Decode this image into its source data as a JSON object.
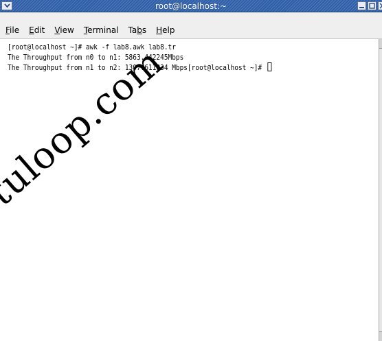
{
  "window": {
    "title": "root@localhost:~"
  },
  "menubar": {
    "items": [
      {
        "mnemonic": "F",
        "rest": "ile"
      },
      {
        "mnemonic": "E",
        "rest": "dit"
      },
      {
        "mnemonic": "V",
        "rest": "iew"
      },
      {
        "mnemonic": "T",
        "rest": "erminal"
      },
      {
        "pre": "Ta",
        "mnemonic": "b",
        "rest": "s"
      },
      {
        "mnemonic": "H",
        "rest": "elp"
      }
    ]
  },
  "terminal": {
    "lines": [
      "[root@localhost ~]# awk -f lab8.awk lab8.tr",
      "The Throughput from n0 to n1: 5863.442245Mbps",
      "The Throughput from n1 to n2: 1307.611834 Mbps[root@localhost ~]# "
    ]
  },
  "watermark": {
    "text": "vtuloop.com"
  },
  "icons": {
    "window_menu": "chevron-down-icon",
    "minimize": "minimize-icon",
    "maximize": "maximize-icon",
    "close": "close-icon"
  },
  "colors": {
    "titlebar": "#2f5fa8",
    "menubar": "#efefef",
    "terminal_bg": "#ffffff",
    "terminal_fg": "#000000"
  }
}
